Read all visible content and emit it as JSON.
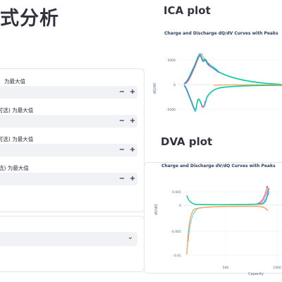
{
  "page": {
    "title": "式分析"
  },
  "params": {
    "fields": [
      {
        "label": "为最大值",
        "minus": "−",
        "plus": "+"
      },
      {
        "label": "(可选) 为最大值",
        "minus": "−",
        "plus": "+"
      },
      {
        "label": "(可选) 为最大值",
        "minus": "−",
        "plus": "+"
      },
      {
        "label": "选) 为最大值",
        "minus": "−",
        "plus": "+"
      }
    ]
  },
  "select": {
    "chevron": "chevron-down-icon"
  },
  "ica": {
    "heading": "ICA plot",
    "chart_title": "Charge and Discharge dQ/dV Curves with Peaks",
    "ylabel": "dQ/dV",
    "yticks": [
      "5000",
      "0",
      "-5000"
    ]
  },
  "dva": {
    "heading": "DVA plot",
    "chart_title": "Charge and Discharge dV/dQ Curves with Peaks",
    "ylabel": "dV/dQ",
    "xlabel": "Capacity",
    "yticks": [
      "0.005",
      "0",
      "-0.005",
      "-0.01"
    ],
    "xticks": [
      "500",
      "1000"
    ]
  },
  "chart_data": [
    {
      "type": "line",
      "title": "Charge and Discharge dQ/dV Curves with Peaks",
      "ylabel": "dQ/dV",
      "ylim": [
        -6500,
        6500
      ],
      "series": [
        {
          "values": [
            0,
            2500,
            5500,
            3500,
            2000,
            800,
            200,
            -400
          ]
        },
        {
          "values": [
            -200,
            -900,
            -1500,
            -6200,
            -2800,
            -5200,
            -1500,
            -200
          ]
        }
      ]
    },
    {
      "type": "line",
      "title": "Charge and Discharge dV/dQ Curves with Peaks",
      "xlabel": "Capacity",
      "ylabel": "dV/dQ",
      "ylim": [
        -0.0105,
        0.0065
      ],
      "series": [
        {
          "values": [
            0.003,
            0.0005,
            0.0001,
            0.0001,
            0.0001,
            0.0002,
            0.0006,
            0.0055
          ]
        },
        {
          "values": [
            -0.01,
            -0.002,
            -0.0006,
            -0.0003,
            -0.0002,
            -0.0002,
            -0.0003,
            -0.0025
          ]
        }
      ]
    }
  ],
  "colors": {
    "accent": "#31333f",
    "input_bg": "#f0f2f6",
    "series": [
      "#636efa",
      "#ef553b",
      "#00cc96",
      "#ab63fa",
      "#ffa15a",
      "#19d3f3",
      "#ff6692",
      "#b6e880"
    ]
  }
}
